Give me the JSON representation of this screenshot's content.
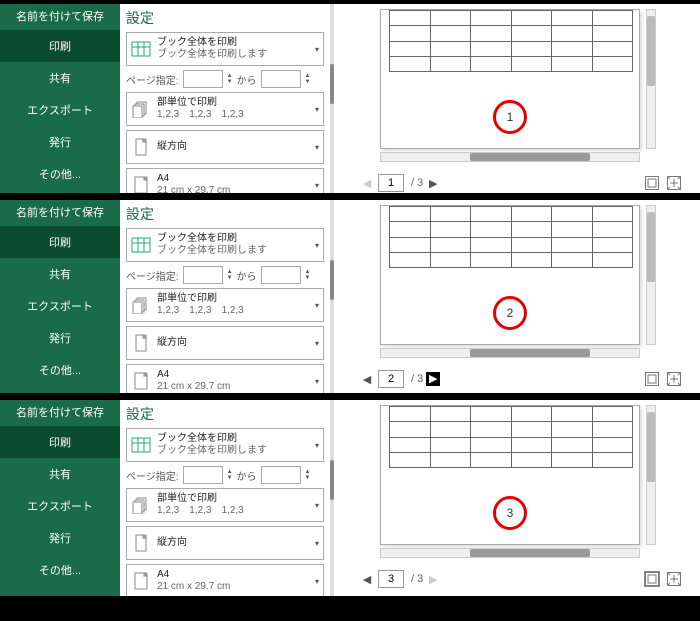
{
  "panels": [
    {
      "pagenum": "1",
      "prev_disabled": true,
      "next_disabled": false,
      "highlight_next": false,
      "margin_boxed": false
    },
    {
      "pagenum": "2",
      "prev_disabled": false,
      "next_disabled": false,
      "highlight_next": true,
      "margin_boxed": false
    },
    {
      "pagenum": "3",
      "prev_disabled": false,
      "next_disabled": true,
      "highlight_next": false,
      "margin_boxed": true
    }
  ],
  "sidebar": {
    "saveas": "名前を付けて保存",
    "print": "印刷",
    "share": "共有",
    "export": "エクスポート",
    "publish": "発行",
    "more": "その他..."
  },
  "settings": {
    "title": "設定",
    "print_what": {
      "l1": "ブック全体を印刷",
      "l2": "ブック全体を印刷します"
    },
    "page_range_label": "ページ指定:",
    "page_range_to": "から",
    "collate": {
      "l1": "部単位で印刷",
      "l2": "1,2,3　1,2,3　1,2,3"
    },
    "orientation": {
      "l1": "縦方向",
      "l2": ""
    },
    "paper": {
      "l1": "A4",
      "l2": "21 cm x 29.7 cm"
    }
  },
  "nav": {
    "total": "/ 3"
  }
}
